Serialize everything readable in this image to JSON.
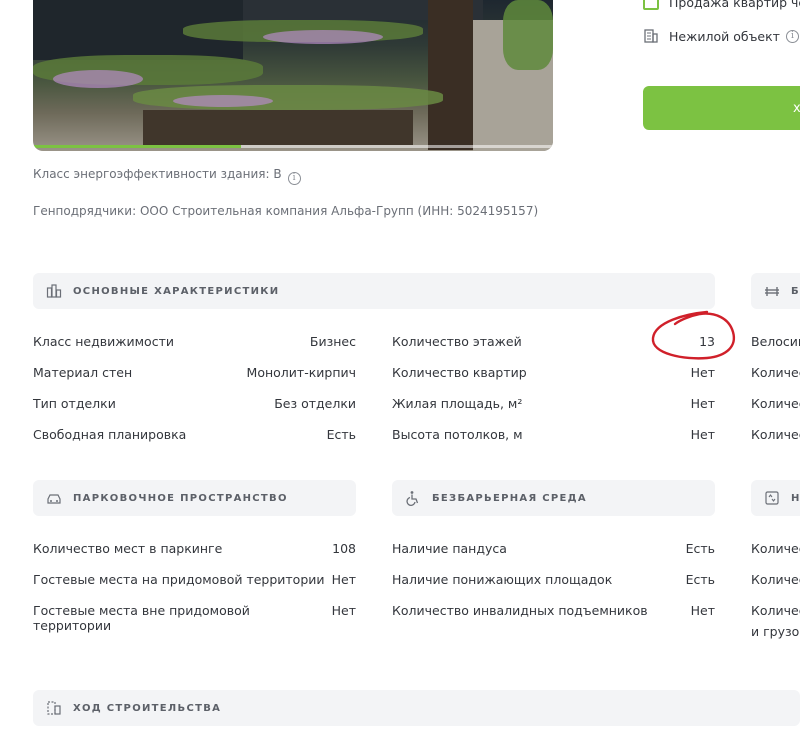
{
  "photo": {
    "progress": 0.4
  },
  "energy": {
    "label": "Класс энергоэффективности здания: B",
    "info": "i"
  },
  "contractor": "Генподрядчики: ООО Строительная компания Альфа-Групп (ИНН: 5024195157)",
  "side": {
    "items": [
      {
        "label": "Продажа квартир че"
      },
      {
        "label": "Нежилой объект"
      }
    ],
    "button_label": "х"
  },
  "sections": {
    "main": {
      "title": "ОСНОВНЫЕ ХАРАКТЕРИСТИКИ",
      "col1": [
        {
          "k": "Класс недвижимости",
          "v": "Бизнес"
        },
        {
          "k": "Материал стен",
          "v": "Монолит-кирпич"
        },
        {
          "k": "Тип отделки",
          "v": "Без отделки"
        },
        {
          "k": "Свободная планировка",
          "v": "Есть"
        }
      ],
      "col2": [
        {
          "k": "Количество этажей",
          "v": "13"
        },
        {
          "k": "Количество квартир",
          "v": "Нет"
        },
        {
          "k": "Жилая площадь, м²",
          "v": "Нет"
        },
        {
          "k": "Высота потолков, м",
          "v": "Нет"
        }
      ]
    },
    "right_top": {
      "title": "Б",
      "rows": [
        "Велосиг",
        "Количес",
        "Количес",
        "Количес"
      ]
    },
    "parking": {
      "title": "ПАРКОВОЧНОЕ ПРОСТРАНСТВО",
      "rows": [
        {
          "k": "Количество мест в паркинге",
          "v": "108"
        },
        {
          "k": "Гостевые места на придомовой территории",
          "v": "Нет"
        },
        {
          "k": "Гостевые места вне придомовой территории",
          "v": "Нет"
        }
      ]
    },
    "barrier": {
      "title": "БЕЗБАРЬЕРНАЯ СРЕДА",
      "rows": [
        {
          "k": "Наличие пандуса",
          "v": "Есть"
        },
        {
          "k": "Наличие понижающих площадок",
          "v": "Есть"
        },
        {
          "k": "Количество инвалидных подъемников",
          "v": "Нет"
        }
      ]
    },
    "right_bottom": {
      "title": "Н",
      "rows": [
        "Количес",
        "Количес",
        "Количес",
        "и грузог"
      ]
    },
    "progress": {
      "title": "ХОД СТРОИТЕЛЬСТВА"
    }
  },
  "colors": {
    "accent": "#7cc242",
    "annotation": "#d0202a",
    "panel": "#f3f4f6"
  }
}
